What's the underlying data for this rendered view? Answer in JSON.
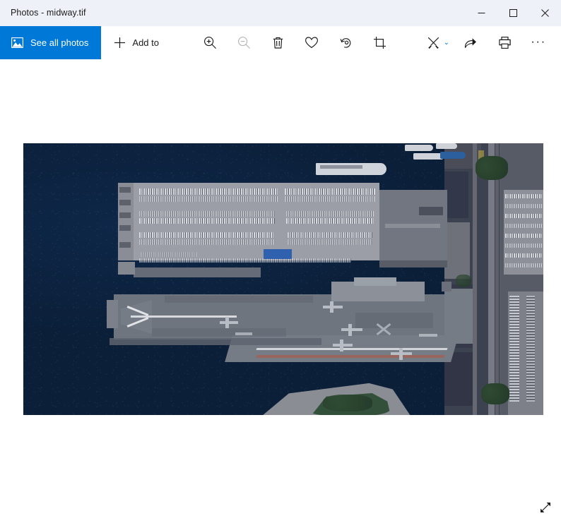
{
  "window": {
    "title": "Photos - midway.tif",
    "app_name": "Photos",
    "file_name": "midway.tif",
    "controls": {
      "minimize": "Minimize",
      "maximize": "Maximize",
      "close": "Close"
    }
  },
  "toolbar": {
    "see_all_photos": "See all photos",
    "see_all_photos_icon": "photo-icon",
    "see_all_photos_color": "#0078d7",
    "add_to": "Add to",
    "add_to_icon": "plus-icon",
    "tools": [
      {
        "name": "zoom-in",
        "label": "Zoom in",
        "icon": "magnifier-plus-icon",
        "enabled": true
      },
      {
        "name": "zoom-out",
        "label": "Zoom out",
        "icon": "magnifier-minus-icon",
        "enabled": false
      },
      {
        "name": "delete",
        "label": "Delete",
        "icon": "trash-icon",
        "enabled": true
      },
      {
        "name": "favorite",
        "label": "Add to favorites",
        "icon": "heart-icon",
        "enabled": true
      },
      {
        "name": "rotate",
        "label": "Rotate",
        "icon": "rotate-icon",
        "enabled": true
      },
      {
        "name": "crop",
        "label": "Crop and rotate",
        "icon": "crop-icon",
        "enabled": true
      }
    ],
    "edit_create": {
      "label": "Edit & Create",
      "icon": "pen-brush-icon",
      "chevron": "chevron-down-icon",
      "chevron_glyph": "⌄",
      "chevron_color": "#0078d7"
    },
    "share": {
      "label": "Share",
      "icon": "share-icon"
    },
    "print": {
      "label": "Print",
      "icon": "print-icon"
    },
    "more": {
      "label": "See more",
      "icon": "ellipsis-icon",
      "glyph": "···"
    }
  },
  "viewer": {
    "image_alt": "Aerial satellite photo of aircraft carrier USS Midway moored at pier with parking lot",
    "background_color": "#ffffff",
    "water_color": "#0c2340",
    "pier_color": "#9b9ea6",
    "land_color": "#3d4250",
    "resize_handle": {
      "name": "fullscreen-toggle",
      "label": "Full screen",
      "icon": "diagonal-arrows-icon"
    }
  }
}
